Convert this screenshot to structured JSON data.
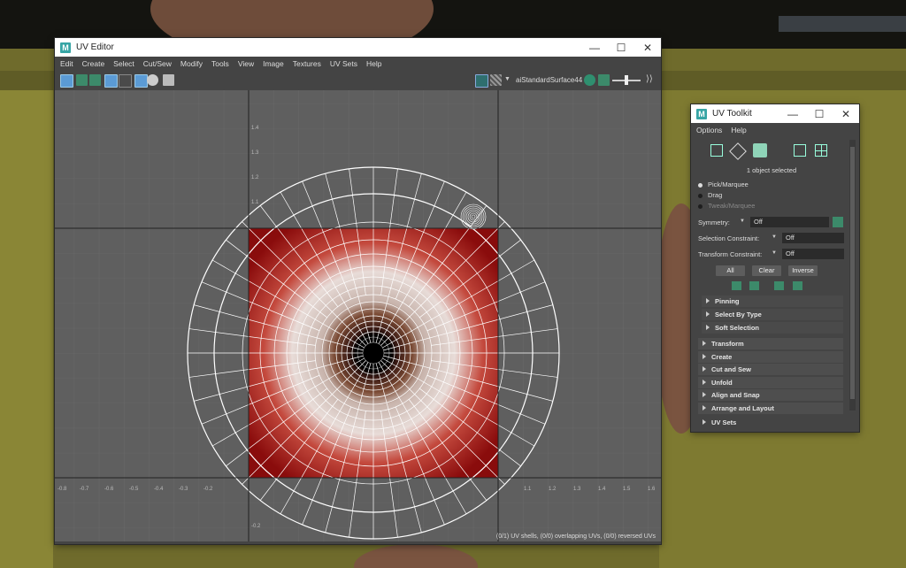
{
  "uv_editor": {
    "title": "UV Editor",
    "menu": [
      "Edit",
      "Create",
      "Select",
      "Cut/Sew",
      "Modify",
      "Tools",
      "View",
      "Image",
      "Textures",
      "UV Sets",
      "Help"
    ],
    "material": "aiStandardSurface44",
    "status": "(0/1) UV shells, (0/0) overlapping UVs, (0/0) reversed UVs",
    "x_ticks": [
      "-0.8",
      "-0.7",
      "-0.6",
      "-0.5",
      "-0.4",
      "-0.3",
      "-0.2",
      "1.1",
      "1.2",
      "1.3",
      "1.4",
      "1.5",
      "1.6"
    ],
    "y_ticks": [
      "1.4",
      "1.3",
      "1.2",
      "1.1",
      "-0.2",
      "-0.3",
      "-0.4"
    ]
  },
  "uv_toolkit": {
    "title": "UV Toolkit",
    "menu": [
      "Options",
      "Help"
    ],
    "selection_text": "1 object selected",
    "modes": [
      "Pick/Marquee",
      "Drag",
      "Tweak/Marquee"
    ],
    "symmetry_label": "Symmetry:",
    "symmetry_value": "Off",
    "selection_constraint_label": "Selection Constraint:",
    "selection_constraint_value": "Off",
    "transform_constraint_label": "Transform Constraint:",
    "transform_constraint_value": "Off",
    "buttons": [
      "All",
      "Clear",
      "Inverse"
    ],
    "sub_sections": [
      "Pinning",
      "Select By Type",
      "Soft Selection"
    ],
    "sections": [
      "Transform",
      "Create",
      "Cut and Sew",
      "Unfold",
      "Align and Snap",
      "Arrange and Layout"
    ],
    "bottom_section": "UV Sets"
  },
  "colors": {
    "texture_red": "#8a0c0c",
    "accent_teal": "#37a5a5"
  }
}
